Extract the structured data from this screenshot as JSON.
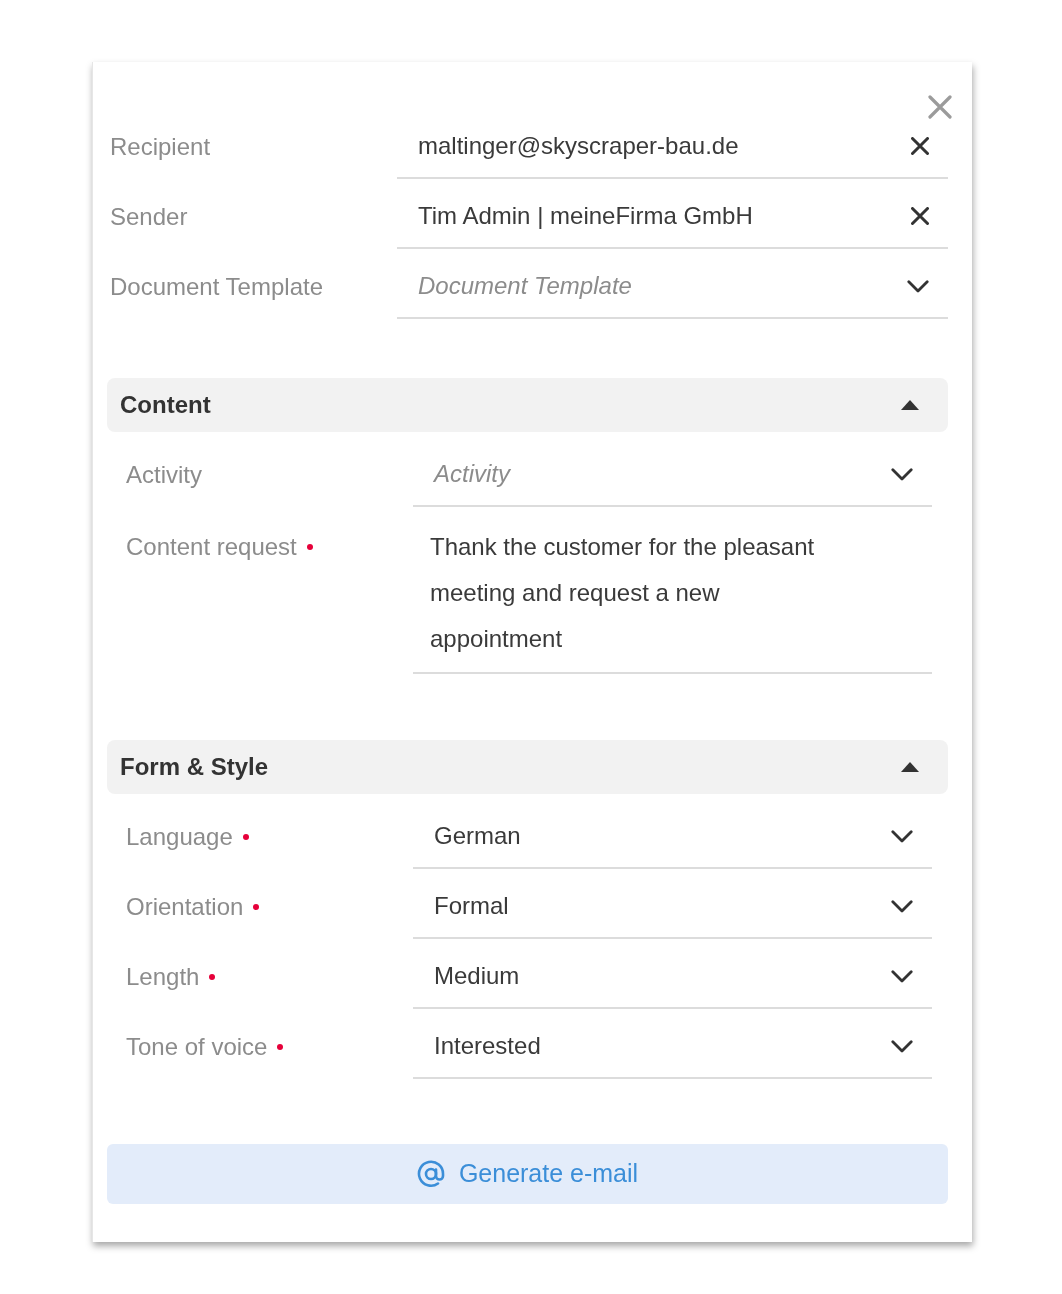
{
  "fields": [
    {
      "kind": "clearable",
      "label": "Recipient",
      "value": "maltinger@skyscraper-bau.de",
      "required": false
    },
    {
      "kind": "clearable",
      "label": "Sender",
      "value": "Tim Admin | meineFirma GmbH",
      "required": false
    },
    {
      "kind": "dropdown",
      "label": "Document Template",
      "placeholder": "Document Template",
      "required": false
    }
  ],
  "sections": [
    {
      "title": "Content",
      "expanded": true,
      "fields": [
        {
          "kind": "dropdown",
          "label": "Activity",
          "placeholder": "Activity",
          "required": false
        },
        {
          "kind": "textarea",
          "label": "Content request",
          "value": "Thank the customer for the pleasant meeting and request a new appointment",
          "required": true
        }
      ]
    },
    {
      "title": "Form & Style",
      "expanded": true,
      "fields": [
        {
          "kind": "dropdown",
          "label": "Language",
          "value": "German",
          "required": true
        },
        {
          "kind": "dropdown",
          "label": "Orientation",
          "value": "Formal",
          "required": true
        },
        {
          "kind": "dropdown",
          "label": "Length",
          "value": "Medium",
          "required": true
        },
        {
          "kind": "dropdown",
          "label": "Tone of voice",
          "value": "Interested",
          "required": true
        }
      ]
    }
  ],
  "generate_button": {
    "label": "Generate e-mail"
  }
}
